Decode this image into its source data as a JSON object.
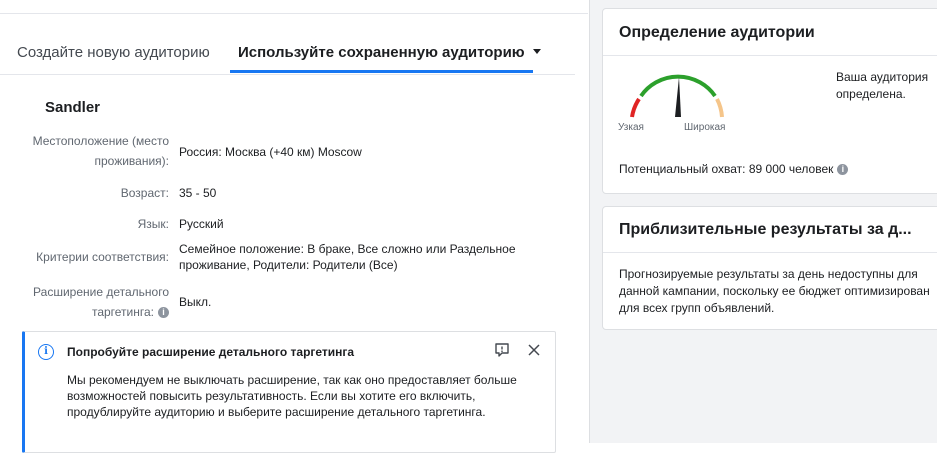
{
  "tabs": {
    "create_new": "Создайте новую аудиторию",
    "use_saved": "Используйте сохраненную аудиторию"
  },
  "audience": {
    "name": "Sandler",
    "rows": [
      {
        "label_line1": "Местоположение (место",
        "label_line2": "проживания):",
        "value": "Россия: Москва (+40 км) Moscow"
      },
      {
        "label": "Возраст:",
        "value": "35 - 50"
      },
      {
        "label": "Язык:",
        "value": "Русский"
      },
      {
        "label": "Критерии соответствия:",
        "value": "Семейное положение: В браке, Все сложно или Раздельное проживание, Родители: Родители (Все)"
      },
      {
        "label_line1": "Расширение детального",
        "label_line2": "таргетинга:",
        "value": "Выкл."
      }
    ]
  },
  "notice": {
    "title": "Попробуйте расширение детального таргетинга",
    "body": "Мы рекомендуем не выключать расширение, так как оно предоставляет больше возможностей повысить результативность. Если вы хотите его включить, продублируйте аудиторию и выберите расширение детального таргетинга."
  },
  "definition_card": {
    "title": "Определение аудитории",
    "narrow": "Узкая",
    "wide": "Широкая",
    "status": "Ваша аудитория определена.",
    "reach": "Потенциальный охват: 89 000 человек",
    "gauge_colors": {
      "narrow": "#e02424",
      "ok": "#2ca02c",
      "wide": "#f5c58a"
    }
  },
  "results_card": {
    "title": "Приблизительные результаты за д...",
    "body": "Прогнозируемые результаты за день недоступны для данной кампании, поскольку ее бюджет оптимизирован для всех групп объявлений."
  }
}
